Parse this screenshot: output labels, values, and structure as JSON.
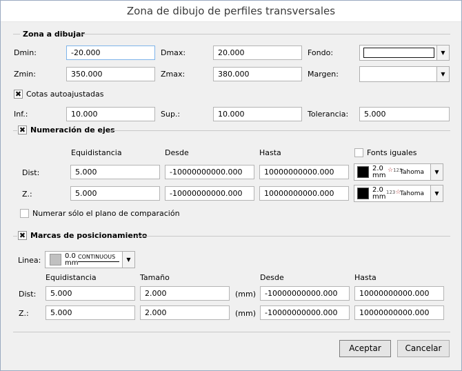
{
  "window": {
    "title": "Zona de dibujo de perfiles transversales"
  },
  "zona": {
    "title": "Zona a dibujar",
    "dmin_label": "Dmin:",
    "dmin_value": "-20.000",
    "dmax_label": "Dmax:",
    "dmax_value": "20.000",
    "fondo_label": "Fondo:",
    "fondo_color": "#ffffff",
    "zmin_label": "Zmin:",
    "zmin_value": "350.000",
    "zmax_label": "Zmax:",
    "zmax_value": "380.000",
    "margen_label": "Margen:",
    "cotas_label": "Cotas autoajustadas",
    "cotas_checked": true,
    "inf_label": "Inf.:",
    "inf_value": "10.000",
    "sup_label": "Sup.:",
    "sup_value": "10.000",
    "tol_label": "Tolerancia:",
    "tol_value": "5.000"
  },
  "numeracion": {
    "title": "Numeración de ejes",
    "checked": true,
    "col_equidistancia": "Equidistancia",
    "col_desde": "Desde",
    "col_hasta": "Hasta",
    "fonts_iguales_label": "Fonts iguales",
    "fonts_iguales_checked": false,
    "dist_label": "Dist:",
    "dist_equi": "5.000",
    "dist_desde": "-10000000000.000",
    "dist_hasta": "10000000000.000",
    "z_label": "Z.:",
    "z_equi": "5.000",
    "z_desde": "-10000000000.000",
    "z_hasta": "10000000000.000",
    "font_size": "2.0",
    "font_unit": "mm",
    "font_name": "Tahoma",
    "font_color": "#000000",
    "numerar_label": "Numerar sólo el plano de comparación",
    "numerar_checked": false
  },
  "marcas": {
    "title": "Marcas de posicionamiento",
    "checked": true,
    "linea_label": "Linea:",
    "line_width": "0.0",
    "line_unit": "mm",
    "line_type": "CONTINUOUS",
    "line_color": "#c0c0c0",
    "col_equidistancia": "Equidistancia",
    "col_tamano": "Tamaño",
    "col_desde": "Desde",
    "col_hasta": "Hasta",
    "unit_mm": "(mm)",
    "dist_label": "Dist:",
    "dist_equi": "5.000",
    "dist_tam": "2.000",
    "dist_desde": "-10000000000.000",
    "dist_hasta": "10000000000.000",
    "z_label": "Z.:",
    "z_equi": "5.000",
    "z_tam": "2.000",
    "z_desde": "-10000000000.000",
    "z_hasta": "10000000000.000"
  },
  "buttons": {
    "accept": "Aceptar",
    "cancel": "Cancelar"
  }
}
